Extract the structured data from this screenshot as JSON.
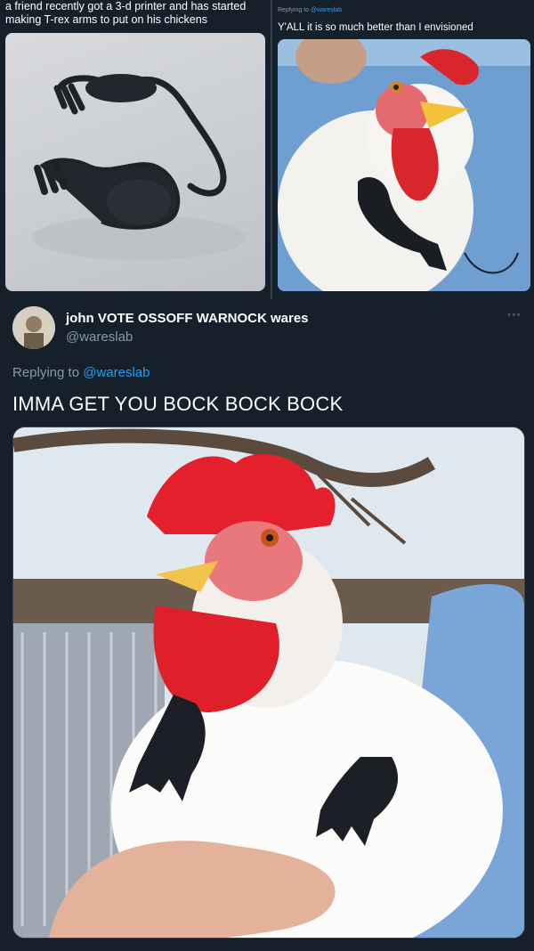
{
  "top_left": {
    "caption": "a friend recently got a 3-d printer and has started making T-rex arms to put on his chickens"
  },
  "top_right": {
    "replying_prefix": "Replying to ",
    "replying_handle": "@wareslab",
    "text": "Y'ALL it is so much better than I envisioned"
  },
  "tweet": {
    "name": "john VOTE OSSOFF WARNOCK wares",
    "handle": "@wareslab",
    "more": "◦◦◦",
    "replying_prefix": "Replying to ",
    "replying_handle": "@wareslab",
    "text": "IMMA GET YOU BOCK BOCK BOCK"
  },
  "colors": {
    "background": "#15202b",
    "link": "#1da1f2",
    "secondary_text": "#8899a6",
    "border": "#38444d"
  }
}
